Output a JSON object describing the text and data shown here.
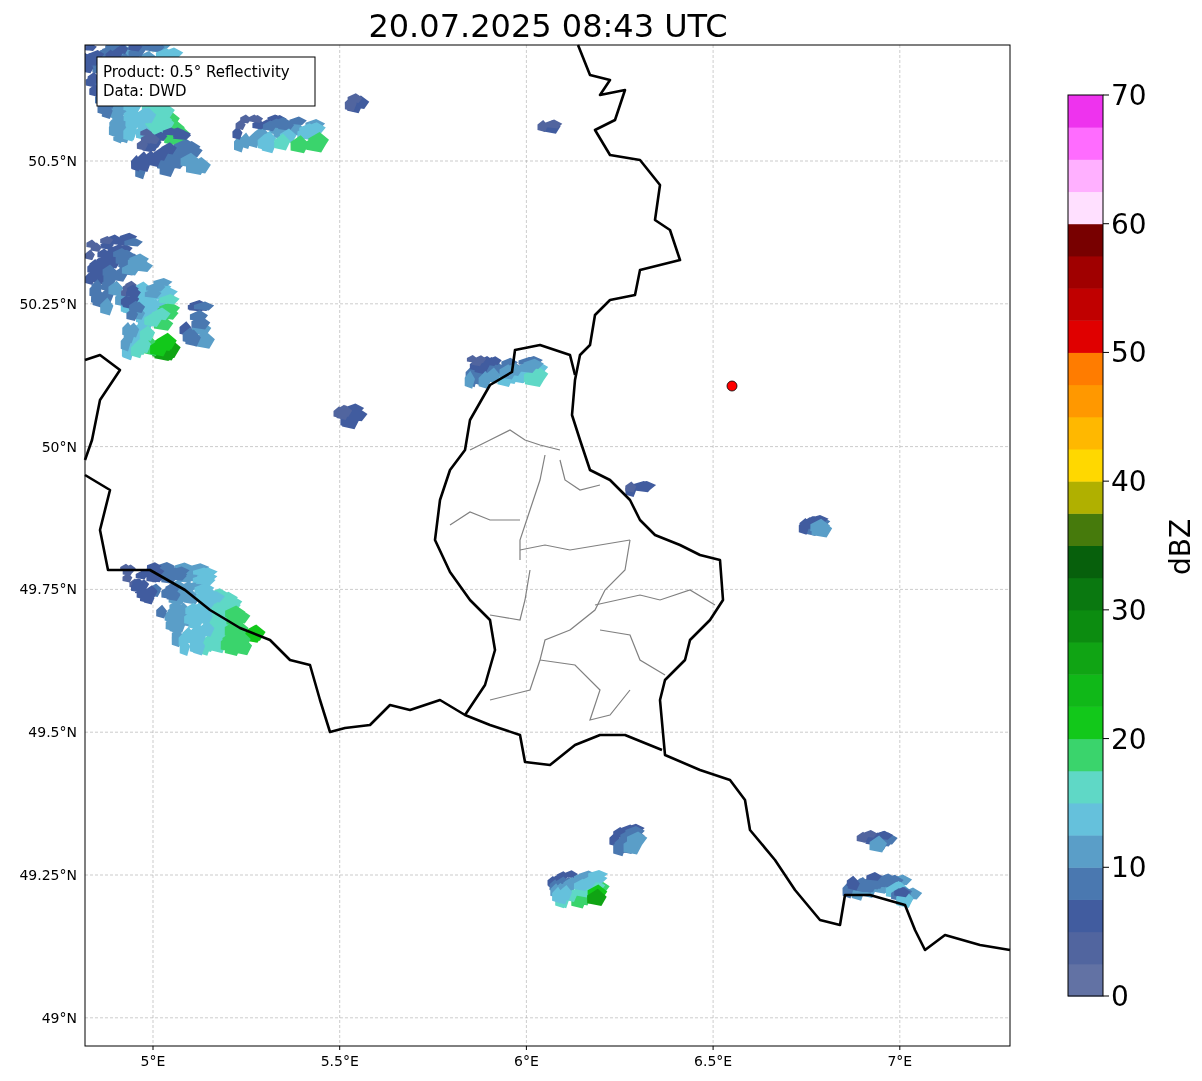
{
  "title": "20.07.2025 08:43 UTC",
  "info_box": {
    "lines": [
      "Product: 0.5° Reflectivity",
      "Data: DWD"
    ]
  },
  "map": {
    "yticks": [
      "50.5°N",
      "50.25°N",
      "50°N",
      "49.75°N",
      "49.5°N",
      "49.25°N",
      "49°N"
    ],
    "xticks": [
      "5°E",
      "5.5°E",
      "6°E",
      "6.5°E",
      "7°E"
    ]
  },
  "colorbar": {
    "label": "dBZ",
    "ticks": [
      "70",
      "60",
      "50",
      "40",
      "30",
      "20",
      "10",
      "0"
    ],
    "segments": [
      {
        "color": "#6272a4"
      },
      {
        "color": "#51659f"
      },
      {
        "color": "#415c9f"
      },
      {
        "color": "#4a78b0"
      },
      {
        "color": "#5a9ec8"
      },
      {
        "color": "#65c1dc"
      },
      {
        "color": "#5fd8c6"
      },
      {
        "color": "#3ad46c"
      },
      {
        "color": "#12c81a"
      },
      {
        "color": "#10b818"
      },
      {
        "color": "#10a414"
      },
      {
        "color": "#0c8c10"
      },
      {
        "color": "#0a7810"
      },
      {
        "color": "#07600c"
      },
      {
        "color": "#467a0c"
      },
      {
        "color": "#b0b000"
      },
      {
        "color": "#ffd800"
      },
      {
        "color": "#ffb800"
      },
      {
        "color": "#ff9800"
      },
      {
        "color": "#ff7c00"
      },
      {
        "color": "#e00000"
      },
      {
        "color": "#c00000"
      },
      {
        "color": "#a00000"
      },
      {
        "color": "#780000"
      },
      {
        "color": "#ffe0ff"
      },
      {
        "color": "#ffb0ff"
      },
      {
        "color": "#ff6cff"
      },
      {
        "color": "#ee33ee"
      }
    ]
  }
}
